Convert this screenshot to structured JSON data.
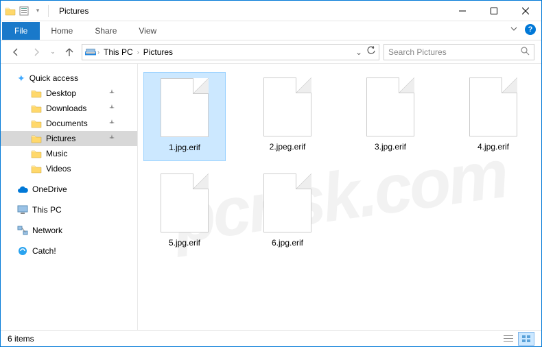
{
  "window": {
    "title": "Pictures"
  },
  "ribbon": {
    "file": "File",
    "tabs": [
      "Home",
      "Share",
      "View"
    ]
  },
  "breadcrumb": {
    "segments": [
      "This PC",
      "Pictures"
    ]
  },
  "search": {
    "placeholder": "Search Pictures"
  },
  "sidebar": {
    "quick_access": {
      "label": "Quick access",
      "items": [
        {
          "label": "Desktop",
          "pinned": true
        },
        {
          "label": "Downloads",
          "pinned": true
        },
        {
          "label": "Documents",
          "pinned": true
        },
        {
          "label": "Pictures",
          "pinned": true,
          "selected": true
        },
        {
          "label": "Music",
          "pinned": false
        },
        {
          "label": "Videos",
          "pinned": false
        }
      ]
    },
    "roots": [
      {
        "label": "OneDrive",
        "icon": "cloud"
      },
      {
        "label": "This PC",
        "icon": "pc"
      },
      {
        "label": "Network",
        "icon": "network"
      },
      {
        "label": "Catch!",
        "icon": "catch"
      }
    ]
  },
  "files": [
    {
      "name": "1.jpg.erif",
      "selected": true
    },
    {
      "name": "2.jpeg.erif"
    },
    {
      "name": "3.jpg.erif"
    },
    {
      "name": "4.jpg.erif"
    },
    {
      "name": "5.jpg.erif"
    },
    {
      "name": "6.jpg.erif"
    }
  ],
  "status": {
    "count": "6 items"
  },
  "watermark": "pcrisk.com"
}
